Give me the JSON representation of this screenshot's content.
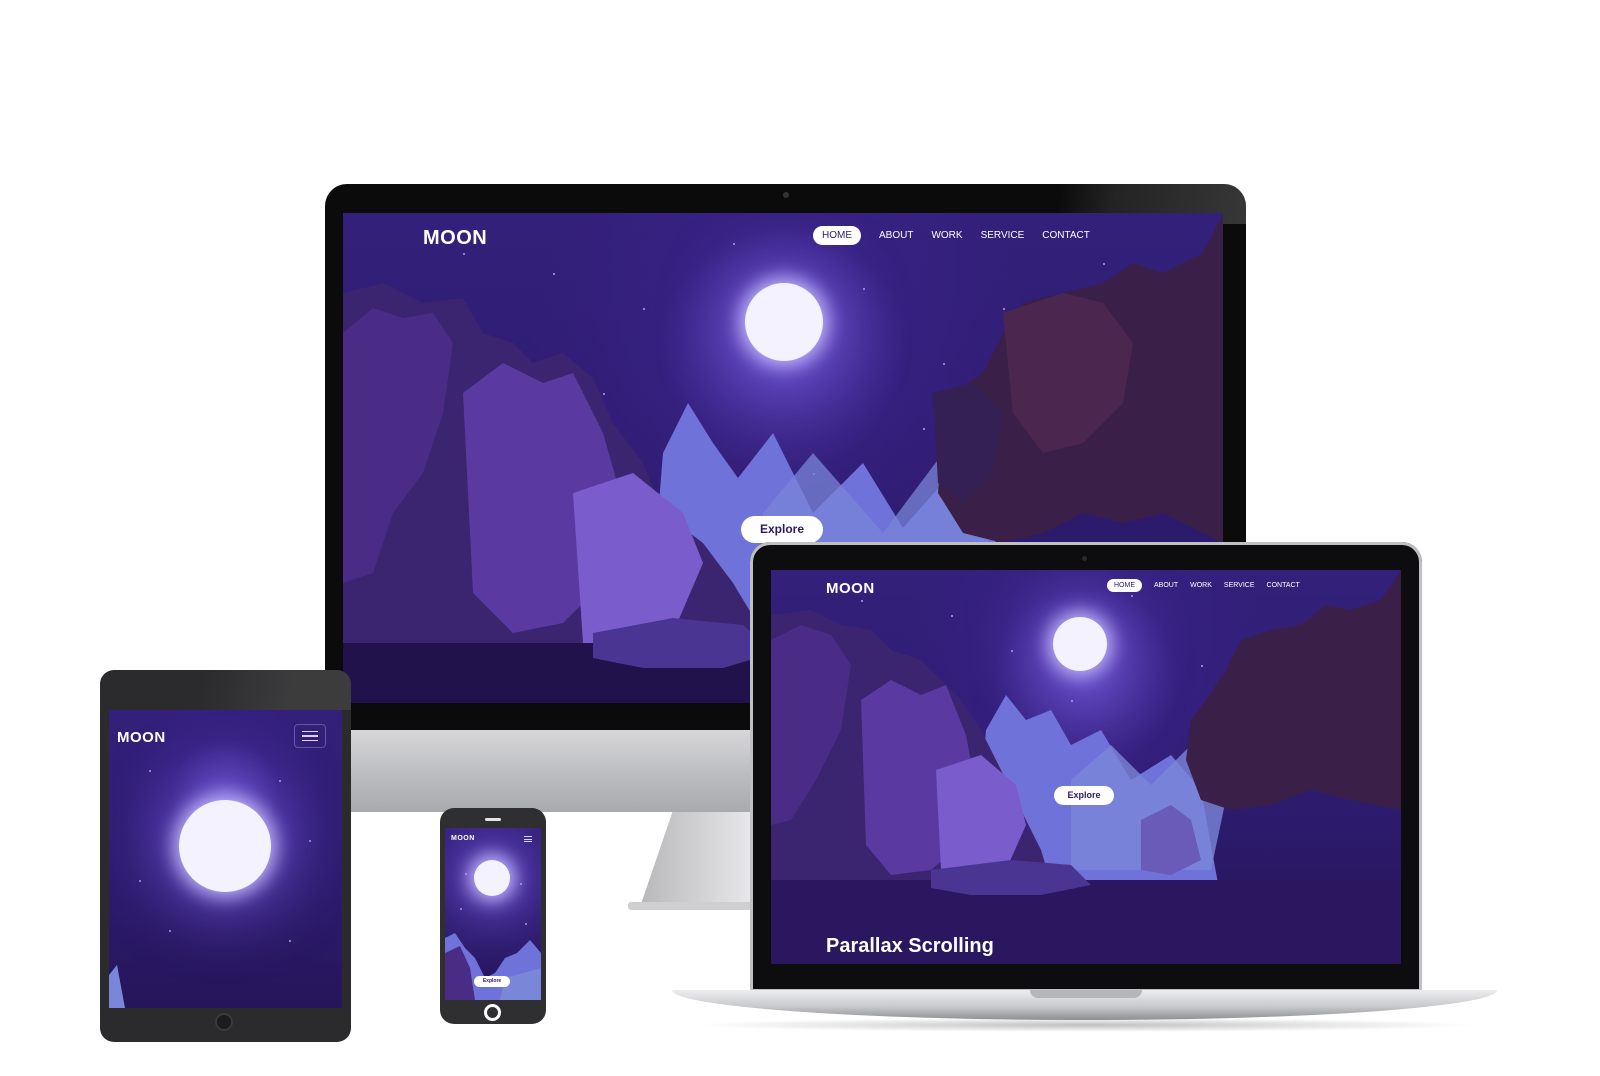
{
  "brand": "MOON",
  "nav": [
    "HOME",
    "ABOUT",
    "WORK",
    "SERVICE",
    "CONTACT"
  ],
  "active_nav": "HOME",
  "cta_label": "Explore",
  "laptop_heading": "Parallax Scrolling",
  "menu_icon": "hamburger-menu-icon",
  "colors": {
    "background": "#2e1a66",
    "moon": "#f4f2ff",
    "accent": "#ffffff"
  }
}
